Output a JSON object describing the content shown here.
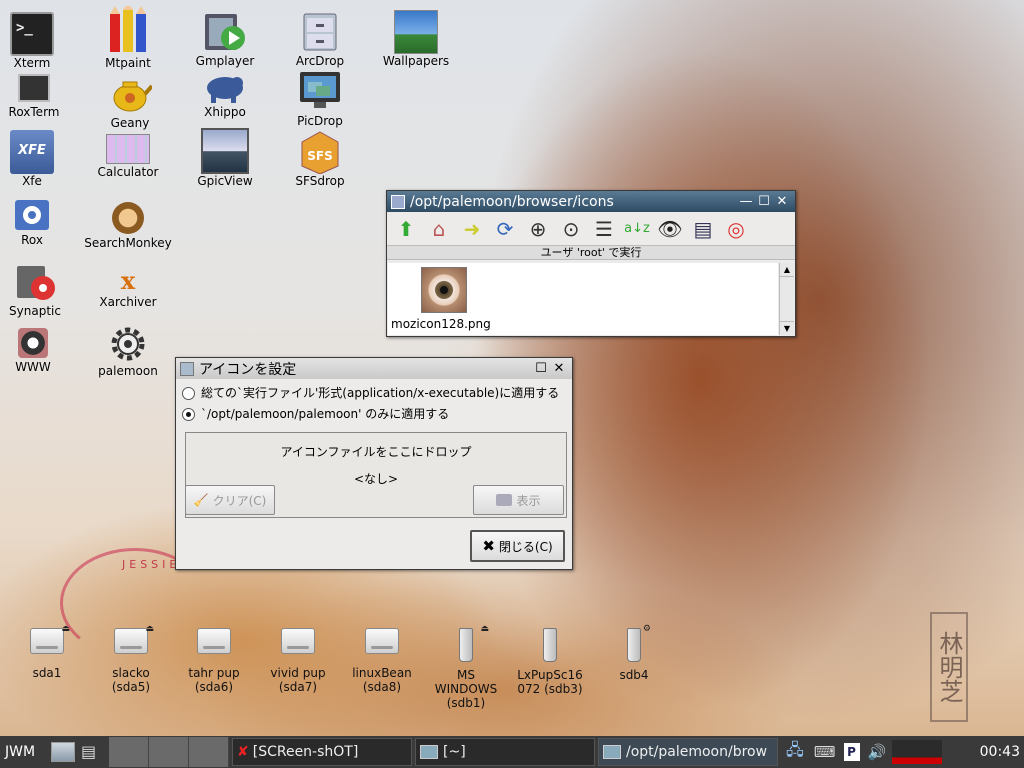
{
  "desktop": {
    "icons": [
      {
        "label": "Xterm"
      },
      {
        "label": "Mtpaint"
      },
      {
        "label": "Gmplayer"
      },
      {
        "label": "ArcDrop"
      },
      {
        "label": "Wallpapers"
      },
      {
        "label": "RoxTerm"
      },
      {
        "label": "Geany"
      },
      {
        "label": "Xhippo"
      },
      {
        "label": "PicDrop"
      },
      {
        "label": "Xfe"
      },
      {
        "label": "Calculator"
      },
      {
        "label": "GpicView"
      },
      {
        "label": "SFSdrop"
      },
      {
        "label": "Rox"
      },
      {
        "label": "SearchMonkey"
      },
      {
        "label": "Synaptic"
      },
      {
        "label": "Xarchiver"
      },
      {
        "label": "WWW"
      },
      {
        "label": "palemoon"
      }
    ],
    "drives": [
      {
        "label": "sda1"
      },
      {
        "label": "slacko\n(sda5)"
      },
      {
        "label": "tahr pup\n(sda6)"
      },
      {
        "label": "vivid pup\n(sda7)"
      },
      {
        "label": "linuxBean\n(sda8)"
      },
      {
        "label": "MS\nWINDOWS\n(sdb1)"
      },
      {
        "label": "LxPupSc16\n072 (sdb3)"
      },
      {
        "label": "sdb4"
      }
    ],
    "wallpaper_text": "JESSIE",
    "seal_text": "林明芝"
  },
  "rox_window": {
    "title": "/opt/palemoon/browser/icons",
    "run_as": "ユーザ 'root' で実行",
    "file": {
      "name": "mozicon128.png"
    }
  },
  "icon_dialog": {
    "title": "アイコンを設定",
    "radio1": "総ての`実行ファイル'形式(application/x-executable)に適用する",
    "radio2": "`/opt/palemoon/palemoon' のみに適用する",
    "drop_label": "アイコンファイルをここにドロップ",
    "drop_value": "<なし>",
    "clear_button": "クリア(C)",
    "show_button": "表示",
    "close_button": "閉じる(C)"
  },
  "taskbar": {
    "menu": "JWM",
    "tasks": [
      {
        "label": "[SCReen-shOT]"
      },
      {
        "label": "[~]"
      },
      {
        "label": "/opt/palemoon/brow"
      }
    ],
    "clock": "00:43"
  },
  "colors": {
    "active_title": "#2e4b63",
    "taskbar": "#3a3a3a",
    "dialog_bg": "#ecebe9"
  }
}
